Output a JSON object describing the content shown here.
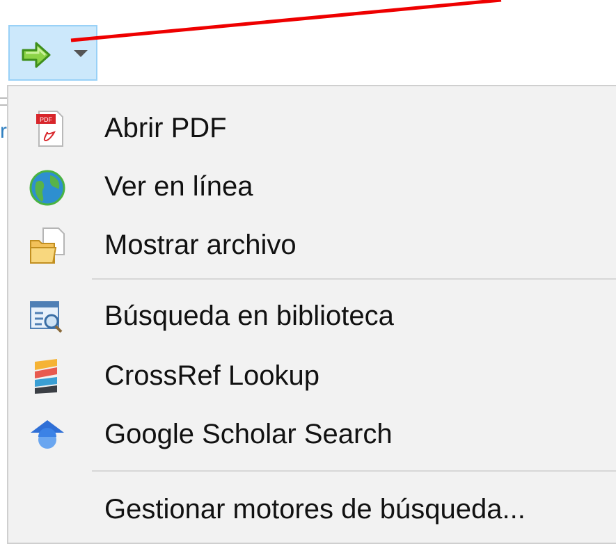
{
  "toolbar": {
    "button": {
      "icon": "green-arrow-icon",
      "dropdown_icon": "chevron-down-icon",
      "bg": "#cce8fb",
      "border": "#99d1f7"
    }
  },
  "annotation": {
    "color": "#ee0000"
  },
  "menu": {
    "groups": [
      [
        {
          "label": "Abrir PDF",
          "icon": "pdf-icon"
        },
        {
          "label": "Ver en línea",
          "icon": "globe-icon"
        },
        {
          "label": "Mostrar archivo",
          "icon": "folder-file-icon"
        }
      ],
      [
        {
          "label": "Búsqueda en biblioteca",
          "icon": "library-lookup-icon"
        },
        {
          "label": "CrossRef Lookup",
          "icon": "crossref-icon"
        },
        {
          "label": "Google Scholar Search",
          "icon": "google-scholar-icon"
        }
      ],
      [
        {
          "label": "Gestionar motores de búsqueda...",
          "icon": ""
        }
      ]
    ]
  }
}
